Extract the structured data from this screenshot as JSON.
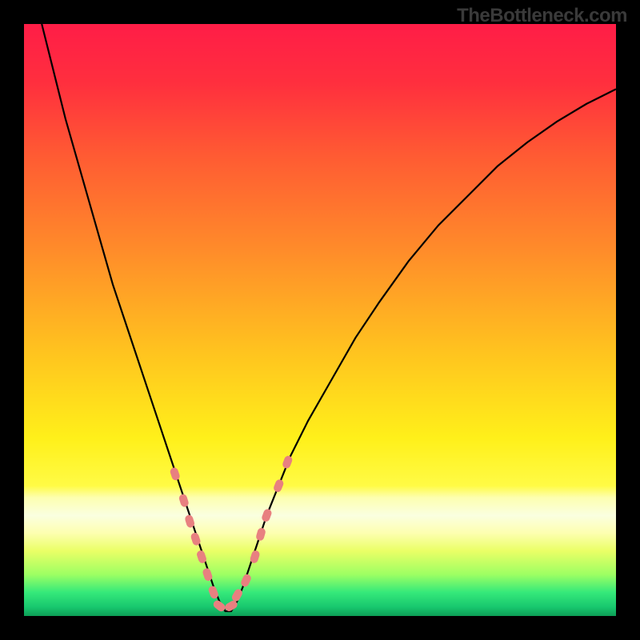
{
  "watermark": "TheBottleneck.com",
  "colors": {
    "frame": "#000000",
    "curve": "#000000",
    "marker": "#e88080",
    "gradient_stops": [
      {
        "offset": 0.0,
        "color": "#ff1d47"
      },
      {
        "offset": 0.1,
        "color": "#ff2f3e"
      },
      {
        "offset": 0.22,
        "color": "#ff5a33"
      },
      {
        "offset": 0.38,
        "color": "#ff8b2a"
      },
      {
        "offset": 0.55,
        "color": "#ffc21f"
      },
      {
        "offset": 0.7,
        "color": "#fff01a"
      },
      {
        "offset": 0.78,
        "color": "#fffb45"
      },
      {
        "offset": 0.8,
        "color": "#fdffb0"
      },
      {
        "offset": 0.83,
        "color": "#faffe0"
      },
      {
        "offset": 0.86,
        "color": "#fdffb0"
      },
      {
        "offset": 0.89,
        "color": "#eaff66"
      },
      {
        "offset": 0.93,
        "color": "#9dff63"
      },
      {
        "offset": 0.96,
        "color": "#35e97a"
      },
      {
        "offset": 0.985,
        "color": "#18c76e"
      },
      {
        "offset": 1.0,
        "color": "#0d9e56"
      }
    ]
  },
  "chart_data": {
    "type": "line",
    "title": "",
    "xlabel": "",
    "ylabel": "",
    "xlim": [
      0,
      100
    ],
    "ylim": [
      0,
      100
    ],
    "grid": false,
    "legend": false,
    "notch_x": 34,
    "series": [
      {
        "name": "bottleneck-curve",
        "x": [
          3,
          5,
          7,
          9,
          11,
          13,
          15,
          17,
          19,
          21,
          23,
          25,
          26,
          27,
          28,
          29,
          30,
          31,
          32,
          33,
          34,
          35,
          36,
          37,
          38,
          39,
          40,
          41,
          43,
          45,
          48,
          52,
          56,
          60,
          65,
          70,
          75,
          80,
          85,
          90,
          95,
          100
        ],
        "y": [
          100,
          92,
          84,
          77,
          70,
          63,
          56,
          50,
          44,
          38,
          32,
          26,
          23,
          20,
          17,
          14,
          11,
          8,
          5,
          2.5,
          0.8,
          0.8,
          2.5,
          5,
          8,
          11,
          14,
          17,
          22,
          27,
          33,
          40,
          47,
          53,
          60,
          66,
          71,
          76,
          80,
          83.5,
          86.5,
          89
        ]
      }
    ],
    "markers": {
      "name": "highlighted-points",
      "shape": "rounded-bar",
      "x": [
        25.5,
        27,
        28,
        29,
        30,
        31,
        32,
        33,
        35,
        36,
        37.5,
        39,
        40,
        41,
        43,
        44.5
      ],
      "y": [
        24,
        19.5,
        16,
        13,
        10,
        7,
        4,
        1.7,
        1.7,
        3.5,
        6,
        10,
        13.8,
        17,
        22,
        26
      ]
    }
  }
}
